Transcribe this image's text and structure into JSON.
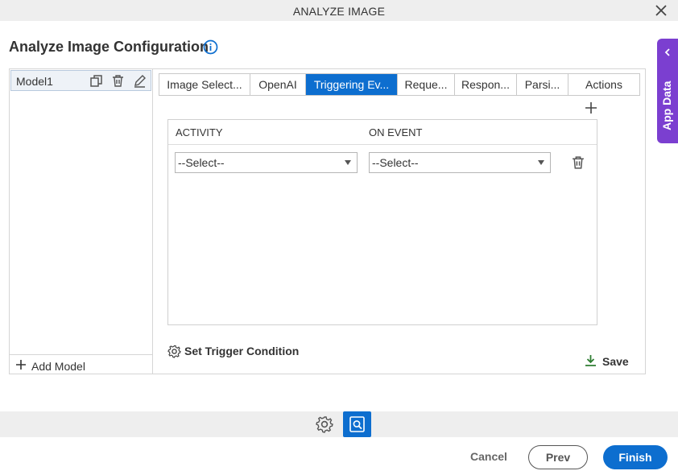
{
  "window": {
    "title": "ANALYZE IMAGE"
  },
  "page": {
    "heading": "Analyze Image Configuration"
  },
  "models": {
    "items": [
      {
        "name": "Model1"
      }
    ],
    "add_label": "Add Model"
  },
  "tabs": [
    {
      "label": "Image Select...",
      "active": false
    },
    {
      "label": "OpenAI",
      "active": false
    },
    {
      "label": "Triggering Ev...",
      "active": true
    },
    {
      "label": "Reque...",
      "active": false
    },
    {
      "label": "Respon...",
      "active": false
    },
    {
      "label": "Parsi...",
      "active": false
    },
    {
      "label": "Actions",
      "active": false
    }
  ],
  "grid": {
    "columns": [
      "ACTIVITY",
      "ON EVENT"
    ],
    "rows": [
      {
        "activity": "--Select--",
        "on_event": "--Select--"
      }
    ]
  },
  "actions": {
    "trigger_condition": "Set Trigger Condition",
    "save": "Save"
  },
  "side_tab": {
    "label": "App Data"
  },
  "footer": {
    "cancel": "Cancel",
    "prev": "Prev",
    "finish": "Finish"
  },
  "colors": {
    "accent": "#0d6ecf",
    "app_data": "#7b3fd0",
    "save_icon": "#2e7d32"
  },
  "icons": [
    "close-icon",
    "info-icon",
    "duplicate-icon",
    "trash-icon",
    "edit-icon",
    "plus-icon",
    "gear-icon",
    "download-icon",
    "chevron-left-icon",
    "image-search-icon"
  ]
}
